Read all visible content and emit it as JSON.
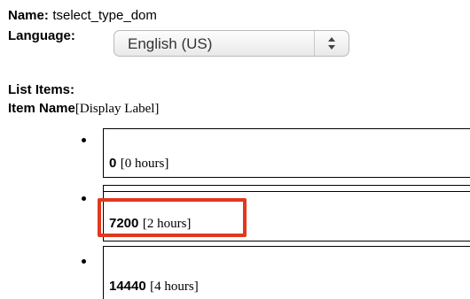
{
  "field": {
    "name_label": "Name:",
    "name_value": "tselect_type_dom",
    "language_label": "Language:",
    "language_selected": "English (US)"
  },
  "list": {
    "list_items_label": "List Items:",
    "item_name_label": "Item Name",
    "display_label_hint": "[Display Label]",
    "items": [
      {
        "name": "0",
        "label": "[0 hours]"
      },
      {
        "name": "7200",
        "label": "[2 hours]"
      },
      {
        "name": "14440",
        "label": "[4 hours]"
      }
    ]
  },
  "colors": {
    "highlight": "#e2381f"
  },
  "icons": {
    "select_arrows": "up-down-arrows-icon"
  }
}
